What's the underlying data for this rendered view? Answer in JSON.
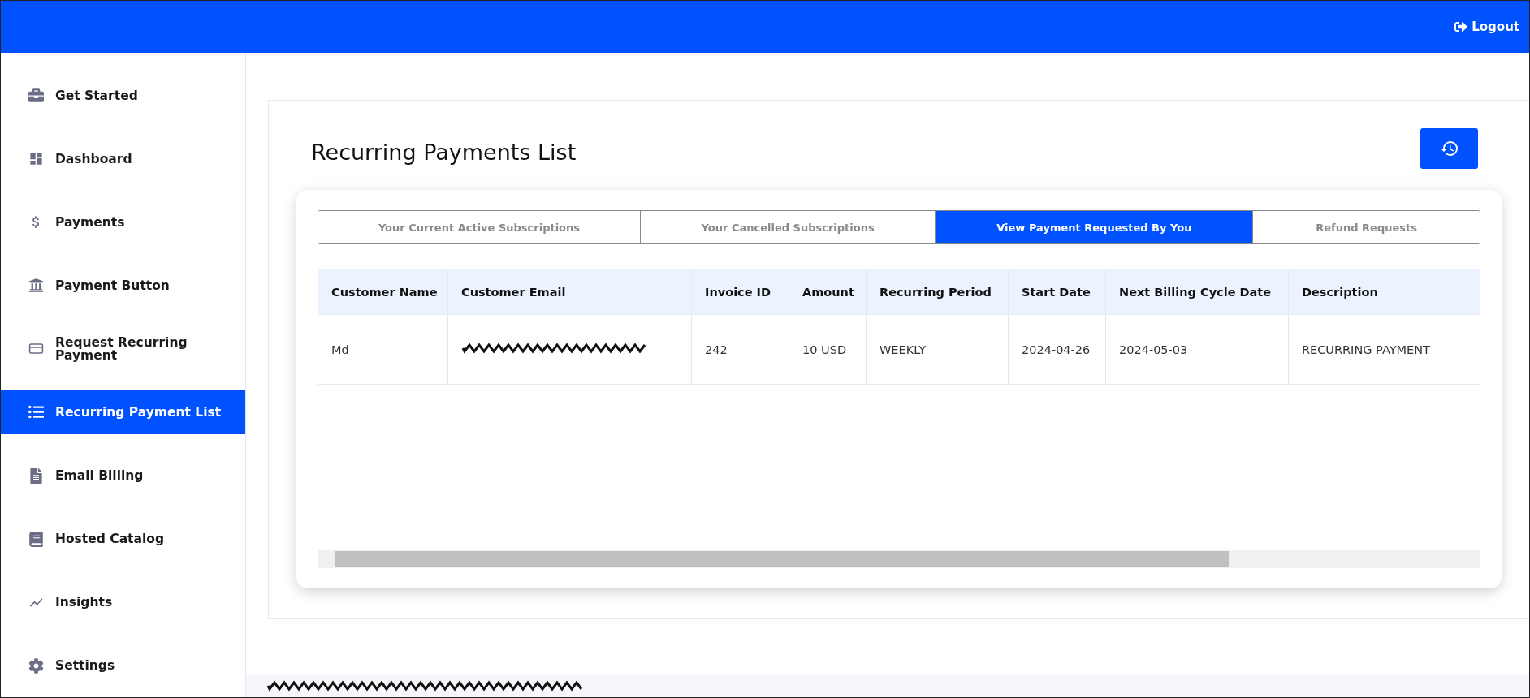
{
  "header": {
    "logout": "Logout"
  },
  "sidebar": {
    "items": [
      {
        "label": "Get Started",
        "selected": false
      },
      {
        "label": "Dashboard",
        "selected": false
      },
      {
        "label": "Payments",
        "selected": false
      },
      {
        "label": "Payment Button",
        "selected": false
      },
      {
        "label": "Request Recurring Payment",
        "selected": false
      },
      {
        "label": "Recurring Payment List",
        "selected": true
      },
      {
        "label": "Email Billing",
        "selected": false
      },
      {
        "label": "Hosted Catalog",
        "selected": false
      },
      {
        "label": "Insights",
        "selected": false
      },
      {
        "label": "Settings",
        "selected": false
      }
    ]
  },
  "page": {
    "title": "Recurring Payments List"
  },
  "tabs": [
    {
      "label": "Your Current Active Subscriptions",
      "selected": false
    },
    {
      "label": "Your Cancelled Subscriptions",
      "selected": false
    },
    {
      "label": "View Payment Requested By You",
      "selected": true
    },
    {
      "label": "Refund Requests",
      "selected": false
    }
  ],
  "table": {
    "columns": [
      "Customer Name",
      "Customer Email",
      "Invoice ID",
      "Amount",
      "Recurring Period",
      "Start Date",
      "Next Billing Cycle Date",
      "Description"
    ],
    "rows": [
      {
        "cells": [
          "Md",
          {
            "kind": "redacted"
          },
          "242",
          "10 USD",
          "WEEKLY",
          "2024-04-26",
          "2024-05-03",
          "RECURRING PAYMENT"
        ]
      }
    ]
  },
  "footer": {
    "kind": "redacted"
  }
}
